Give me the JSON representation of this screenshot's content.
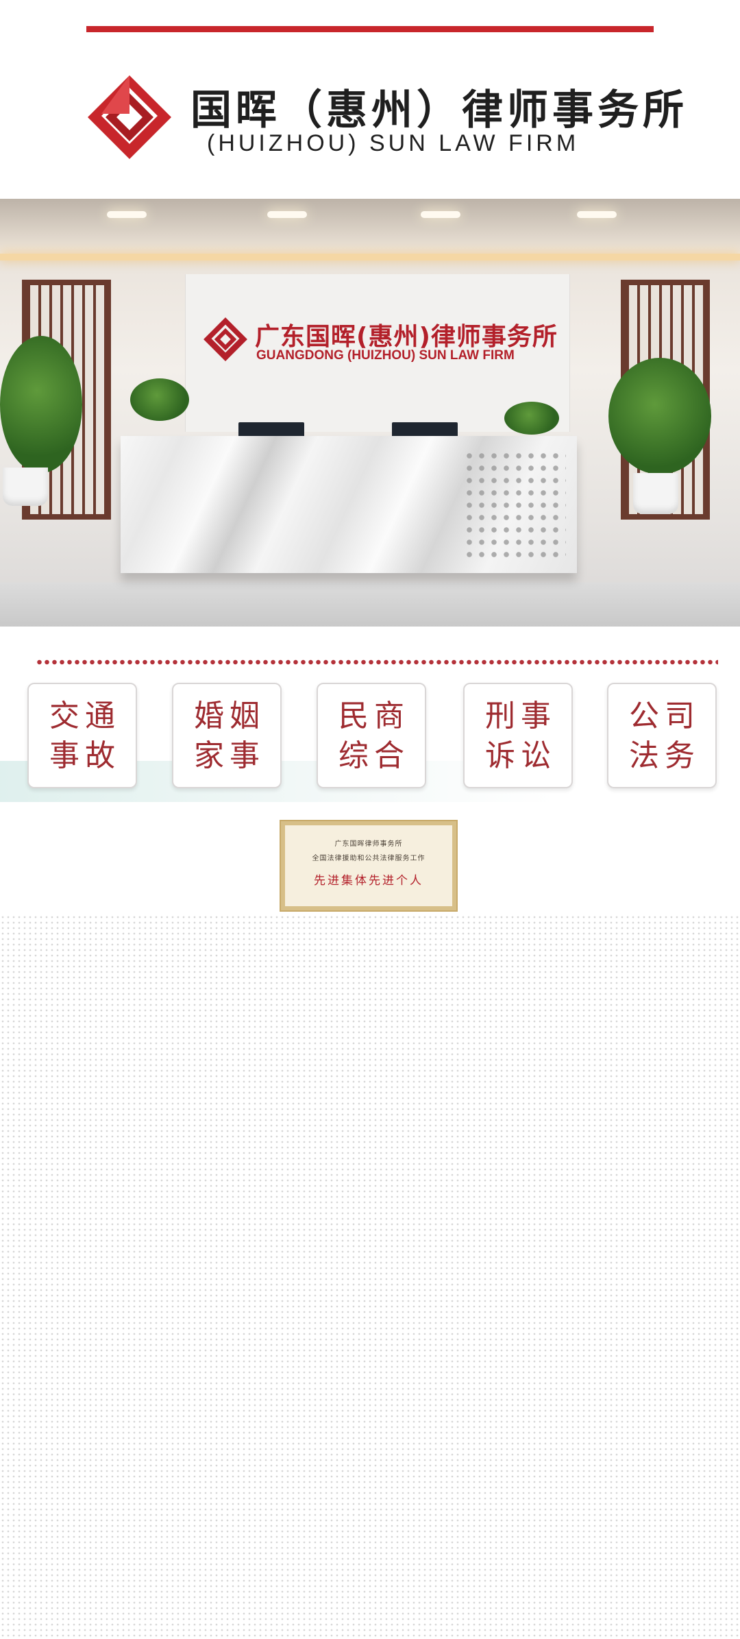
{
  "header": {
    "name_cn": "国晖（惠州）律师事务所",
    "name_en": "(HUIZHOU) SUN LAW FIRM",
    "accent_color": "#c8262b"
  },
  "lobby": {
    "sign_cn": "广东国晖(惠州)律师事务所",
    "sign_en": "GUANGDONG (HUIZHOU) SUN LAW FIRM"
  },
  "services": [
    {
      "line1": "交通",
      "line2": "事故"
    },
    {
      "line1": "婚姻",
      "line2": "家事"
    },
    {
      "line1": "民商",
      "line2": "综合"
    },
    {
      "line1": "刑事",
      "line2": "诉讼"
    },
    {
      "line1": "公司",
      "line2": "法务"
    }
  ],
  "plaque": {
    "line1": "广东国晖律师事务所",
    "line2": "全国法律援助和公共法律服务工作",
    "line3": "先进集体先进个人"
  }
}
